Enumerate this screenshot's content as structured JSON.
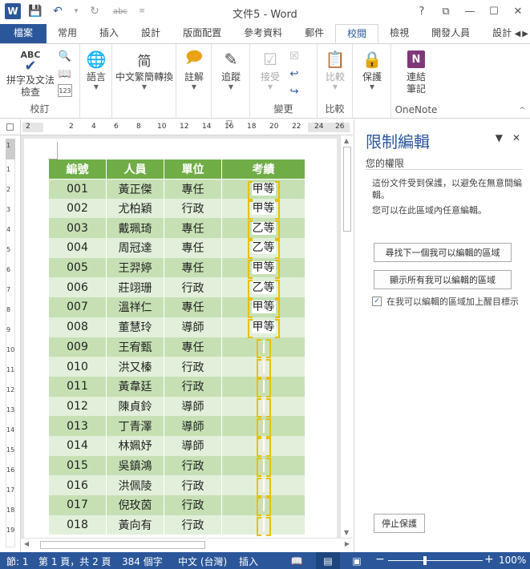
{
  "app": {
    "title": "文件5 - Word",
    "qat": {
      "logo": "W",
      "save_icon": "save-icon",
      "undo_icon": "undo-icon",
      "redo_icon": "redo-icon",
      "strike_label": "abc"
    },
    "window_controls": [
      "?",
      "⧉",
      "—",
      "☐",
      "✕"
    ]
  },
  "tabs": [
    {
      "label": "檔案",
      "kind": "file"
    },
    {
      "label": "常用"
    },
    {
      "label": "插入"
    },
    {
      "label": "設計"
    },
    {
      "label": "版面配置"
    },
    {
      "label": "參考資料"
    },
    {
      "label": "郵件"
    },
    {
      "label": "校閱",
      "active": true
    },
    {
      "label": "檢視"
    },
    {
      "label": "開發人員"
    },
    {
      "label": "設計"
    }
  ],
  "ribbon": {
    "proofing": {
      "abc": "ABC",
      "spell_label_1": "拼字及文法",
      "spell_label_2": "檢查",
      "group": "校訂"
    },
    "language": {
      "label": "語言"
    },
    "chinese": {
      "label": "中文繁簡轉換"
    },
    "comment": {
      "label": "註解"
    },
    "track": {
      "label": "追蹤"
    },
    "changes": {
      "accept_label": "接受",
      "group": "變更"
    },
    "compare": {
      "label": "比較",
      "group": "比較"
    },
    "protect": {
      "label": "保護"
    },
    "onenote": {
      "label_1": "連結",
      "label_2": "筆記",
      "group": "OneNote"
    }
  },
  "ruler": {
    "h_numbers": [
      "2",
      "2",
      "4",
      "6",
      "8",
      "10",
      "12",
      "14",
      "16",
      "18",
      "20",
      "22",
      "24",
      "26"
    ],
    "v_numbers": [
      "1",
      "1",
      "2",
      "3",
      "4",
      "5",
      "6",
      "7",
      "8",
      "9",
      "10",
      "11",
      "12",
      "13",
      "14",
      "15",
      "16",
      "17",
      "18",
      "19"
    ]
  },
  "table": {
    "headers": [
      "編號",
      "人員",
      "單位",
      "考績"
    ],
    "rows": [
      [
        "001",
        "黃正傑",
        "專任",
        "甲等"
      ],
      [
        "002",
        "尤柏穎",
        "行政",
        "甲等"
      ],
      [
        "003",
        "戴珮琦",
        "專任",
        "乙等"
      ],
      [
        "004",
        "周冠達",
        "專任",
        "乙等"
      ],
      [
        "005",
        "王羿婷",
        "專任",
        "甲等"
      ],
      [
        "006",
        "莊翊珊",
        "行政",
        "乙等"
      ],
      [
        "007",
        "溫祥仁",
        "專任",
        "甲等"
      ],
      [
        "008",
        "董慧玲",
        "導師",
        "甲等"
      ],
      [
        "009",
        "王宥甄",
        "專任",
        ""
      ],
      [
        "010",
        "洪又榛",
        "行政",
        ""
      ],
      [
        "011",
        "黃韋廷",
        "行政",
        ""
      ],
      [
        "012",
        "陳貞鈴",
        "導師",
        ""
      ],
      [
        "013",
        "丁青澤",
        "導師",
        ""
      ],
      [
        "014",
        "林姵妤",
        "導師",
        ""
      ],
      [
        "015",
        "吳鎮鴻",
        "行政",
        ""
      ],
      [
        "016",
        "洪佩陵",
        "行政",
        ""
      ],
      [
        "017",
        "倪玫茵",
        "行政",
        ""
      ],
      [
        "018",
        "黃向有",
        "行政",
        ""
      ]
    ]
  },
  "pane": {
    "title": "限制編輯",
    "section": "您的權限",
    "text_1": "這份文件受到保護，以避免在無意間編輯。",
    "text_2": "您可以在此區域內任意編輯。",
    "find_next": "尋找下一個我可以編輯的區域",
    "show_all": "顯示所有我可以編輯的區域",
    "highlight_label": "在我可以編輯的區域加上醒目標示",
    "highlight_checked": true,
    "stop": "停止保護"
  },
  "status": {
    "section": "節: 1",
    "page": "第 1 頁，共 2 頁",
    "words": "384 個字",
    "language": "中文 (台灣)",
    "mode": "插入",
    "zoom": "100%"
  }
}
